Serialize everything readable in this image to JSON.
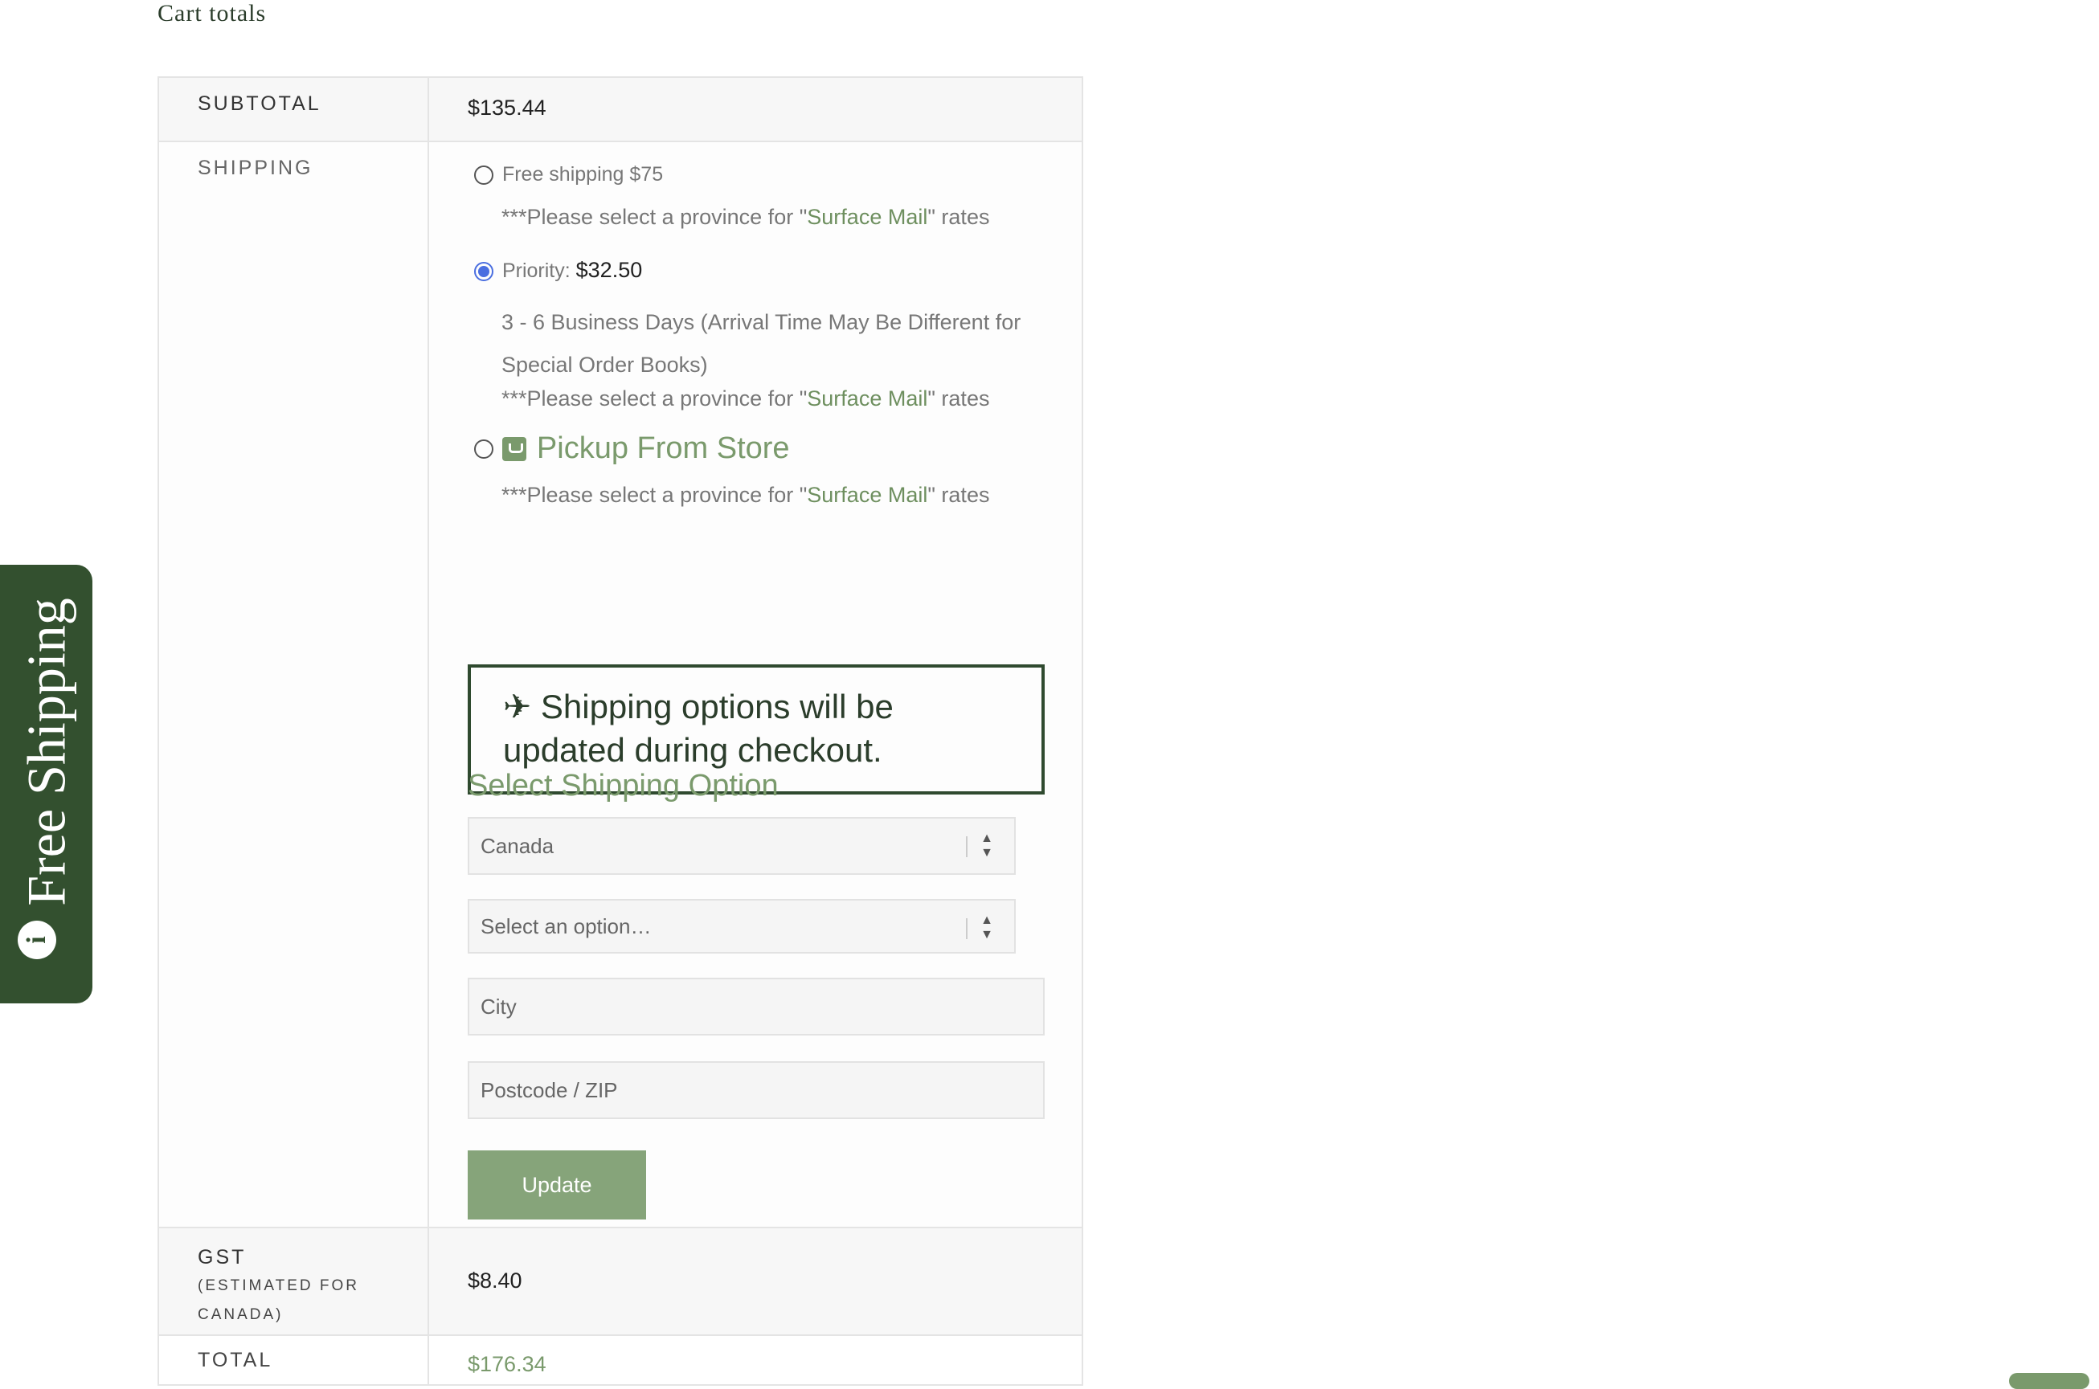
{
  "cart": {
    "title": "Cart totals",
    "subtotal_label": "SUBTOTAL",
    "subtotal_value": "$135.44",
    "shipping_label": "SHIPPING",
    "gst_label": "GST",
    "gst_note": "(ESTIMATED FOR CANADA)",
    "gst_value": "$8.40",
    "total_label": "TOTAL",
    "total_value": "$176.34"
  },
  "shipping": {
    "options": [
      {
        "label": "Free shipping",
        "price": "$75",
        "checked": false
      },
      {
        "label": "Priority:",
        "price": "$32.50",
        "checked": true,
        "description": "3 - 6 Business Days (Arrival Time May Be Different for Special Order Books)"
      },
      {
        "label": "Pickup From Store",
        "price": "",
        "checked": false,
        "icon": "store-icon"
      }
    ],
    "note_prefix": "***Please select a province for \"",
    "note_link": "Surface Mail",
    "note_suffix": "\" rates",
    "notice": "✈ Shipping options will be updated during checkout.",
    "select_heading": "Select Shipping Option",
    "country_value": "Canada",
    "state_placeholder": "Select an option…",
    "city_placeholder": "City",
    "postcode_placeholder": "Postcode / ZIP",
    "update_label": "Update"
  },
  "side_tab": {
    "label": "Free Shipping",
    "info_glyph": "i"
  },
  "colors": {
    "accent_green": "#7a9a6c",
    "dark_green": "#33502f",
    "radio_blue": "#4a6ee0"
  }
}
